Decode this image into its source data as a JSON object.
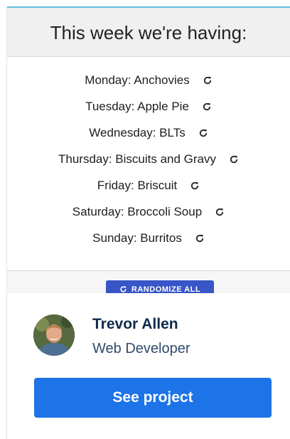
{
  "preview": {
    "title": "This week we're having:",
    "meals": [
      {
        "label": "Monday: Anchovies"
      },
      {
        "label": "Tuesday: Apple Pie"
      },
      {
        "label": "Wednesday: BLTs"
      },
      {
        "label": "Thursday: Biscuits and Gravy"
      },
      {
        "label": "Friday: Briscuit"
      },
      {
        "label": "Saturday: Broccoli Soup"
      },
      {
        "label": "Sunday: Burritos"
      }
    ],
    "randomize_label": "RANDOMIZE ALL",
    "refresh_icon": "refresh-icon",
    "accent_color": "#3856c8"
  },
  "author": {
    "name": "Trevor Allen",
    "role": "Web Developer",
    "avatar_icon": "avatar"
  },
  "cta": {
    "label": "See project",
    "color": "#1d73e8"
  }
}
